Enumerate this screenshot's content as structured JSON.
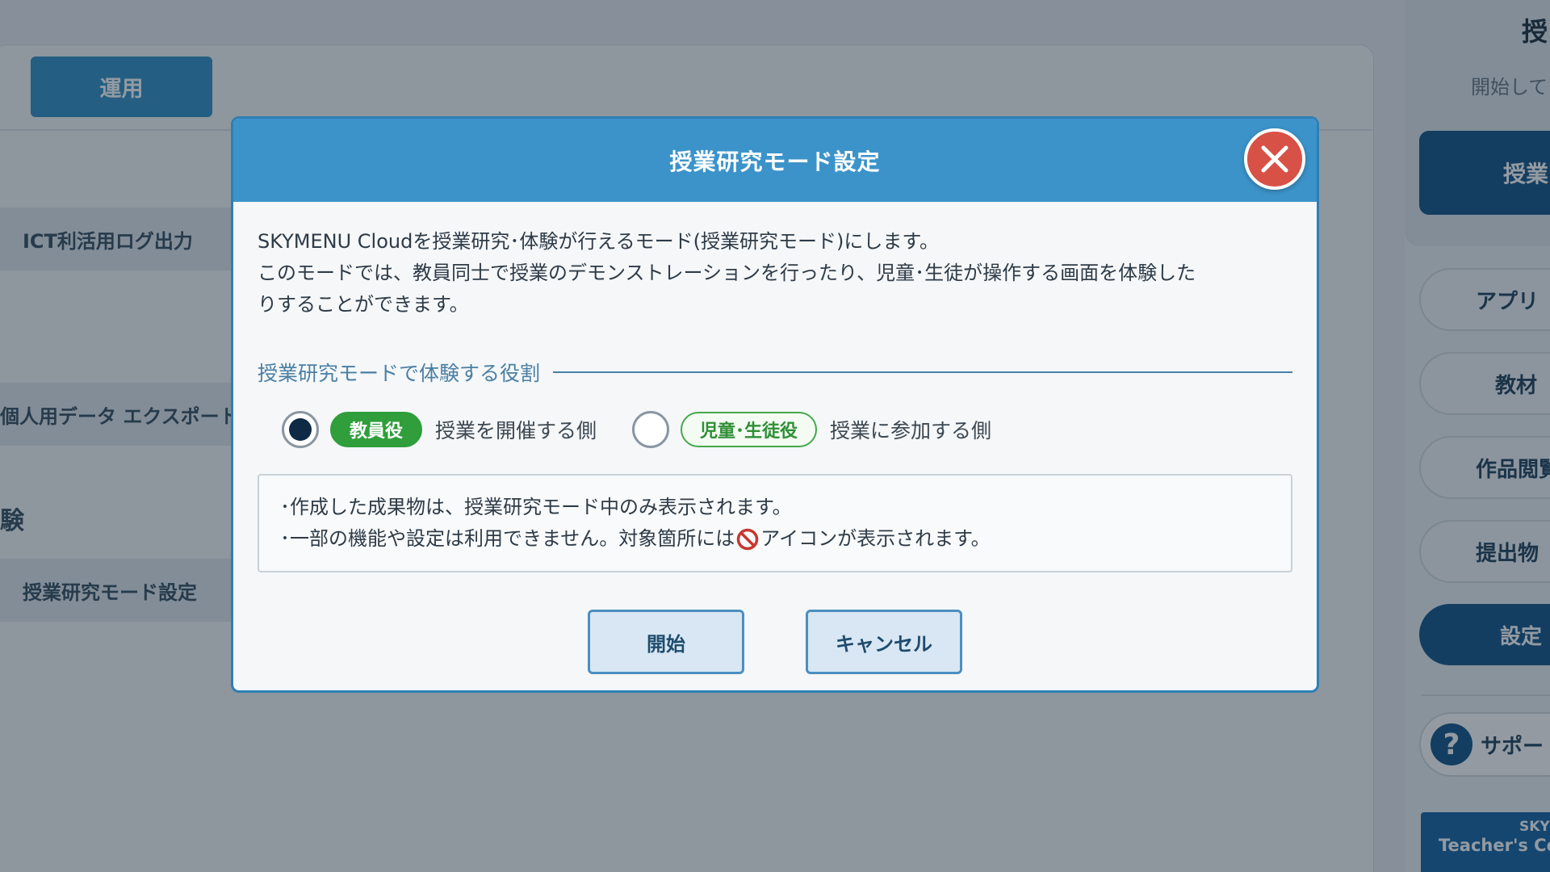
{
  "background": {
    "tab_label": "運用",
    "sidebar_items": [
      "ICT利活用ログ出力",
      "個人用データ エクスポート",
      "授業研究モード設定"
    ],
    "section_heading": "験",
    "right_panel": {
      "title": "授",
      "subtitle": "開始して",
      "primary_button": "授業",
      "menu_items": [
        "アプリ",
        "教材",
        "作品閲覧",
        "提出物"
      ],
      "settings_button": "設定",
      "support_label": "サポート",
      "support_icon": "question-mark-icon",
      "banner_line1": "SKY",
      "banner_line2": "Teacher's Co"
    }
  },
  "dialog": {
    "title": "授業研究モード設定",
    "close_icon": "close-icon",
    "intro_lines": [
      "SKYMENU Cloudを授業研究･体験が行えるモード(授業研究モード)にします。",
      "このモードでは、教員同士で授業のデモンストレーションを行ったり、児童･生徒が操作する画面を体験した",
      "りすることができます。"
    ],
    "section_label": "授業研究モードで体験する役割",
    "roles": [
      {
        "badge": "教員役",
        "description": "授業を開催する側",
        "selected": true
      },
      {
        "badge": "児童･生徒役",
        "description": "授業に参加する側",
        "selected": false
      }
    ],
    "notes": {
      "line1": "･作成した成果物は、授業研究モード中のみ表示されます。",
      "line2_before": "･一部の機能や設定は利用できません。対象箇所には",
      "line2_icon": "prohibited-icon",
      "line2_after": "アイコンが表示されます。"
    },
    "buttons": {
      "start": "開始",
      "cancel": "キャンセル"
    },
    "colors": {
      "header": "#3b93c9",
      "close": "#d85147",
      "badge_green": "#2f9e3b",
      "accent": "#4a7fa3"
    }
  }
}
